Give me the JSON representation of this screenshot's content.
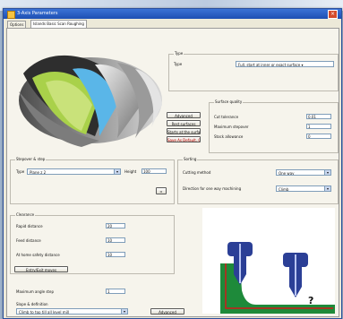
{
  "window": {
    "title": "3-Axis Parameters",
    "close": "×"
  },
  "tabs": [
    {
      "label": "Options"
    },
    {
      "label": "Islands Basic Scan Roughing"
    }
  ],
  "type_group": {
    "legend": "Type",
    "type_label": "Type",
    "type_value": "Full, start at inner or exact surface ▾"
  },
  "side_buttons": {
    "advanced": "Advanced",
    "rest_surfaces": "Rest surfaces",
    "starts_surfaces": "Starts at the surfaces",
    "save_default": "Save As Default, ON?"
  },
  "surface_quality": {
    "legend": "Surface quality",
    "rows": [
      {
        "label": "Cut tolerance",
        "value": "0.01"
      },
      {
        "label": "Maximum stepover",
        "value": "1"
      },
      {
        "label": "Stock allowance",
        "value": "0"
      }
    ]
  },
  "stepover": {
    "legend": "Stepover & step",
    "type_label": "Type",
    "type_value": "Plane z 2",
    "height_label": "Height",
    "height_value": "100"
  },
  "sorting": {
    "legend": "Sorting",
    "cutting_method_label": "Cutting method",
    "cutting_method_value": "One way",
    "direction_label": "Direction for one way machining",
    "direction_value": "Climb"
  },
  "clearance": {
    "legend": "Clearance",
    "rows": [
      {
        "label": "Rapid distance",
        "value": "20"
      },
      {
        "label": "Feed distance",
        "value": "10"
      },
      {
        "label": "At home safety distance",
        "value": "10"
      }
    ]
  },
  "entry_exit_button": "Entry/Exit moves",
  "max_angle": {
    "label": "Maximum angle step",
    "value": "1"
  },
  "slope": {
    "label": "Slope & definition",
    "value": "Climb to top till all level mill",
    "advanced": "Advanced"
  },
  "icons": {
    "app": "app-icon",
    "expand": "expand-icon",
    "question": "?"
  },
  "colors": {
    "titlebar": "#1d4fb3",
    "tool": "#2b3f96",
    "stock": "#1e8a3a",
    "path": "#d11a1a",
    "surface_green": "#b7d94c",
    "surface_blue": "#5ab6e8"
  }
}
